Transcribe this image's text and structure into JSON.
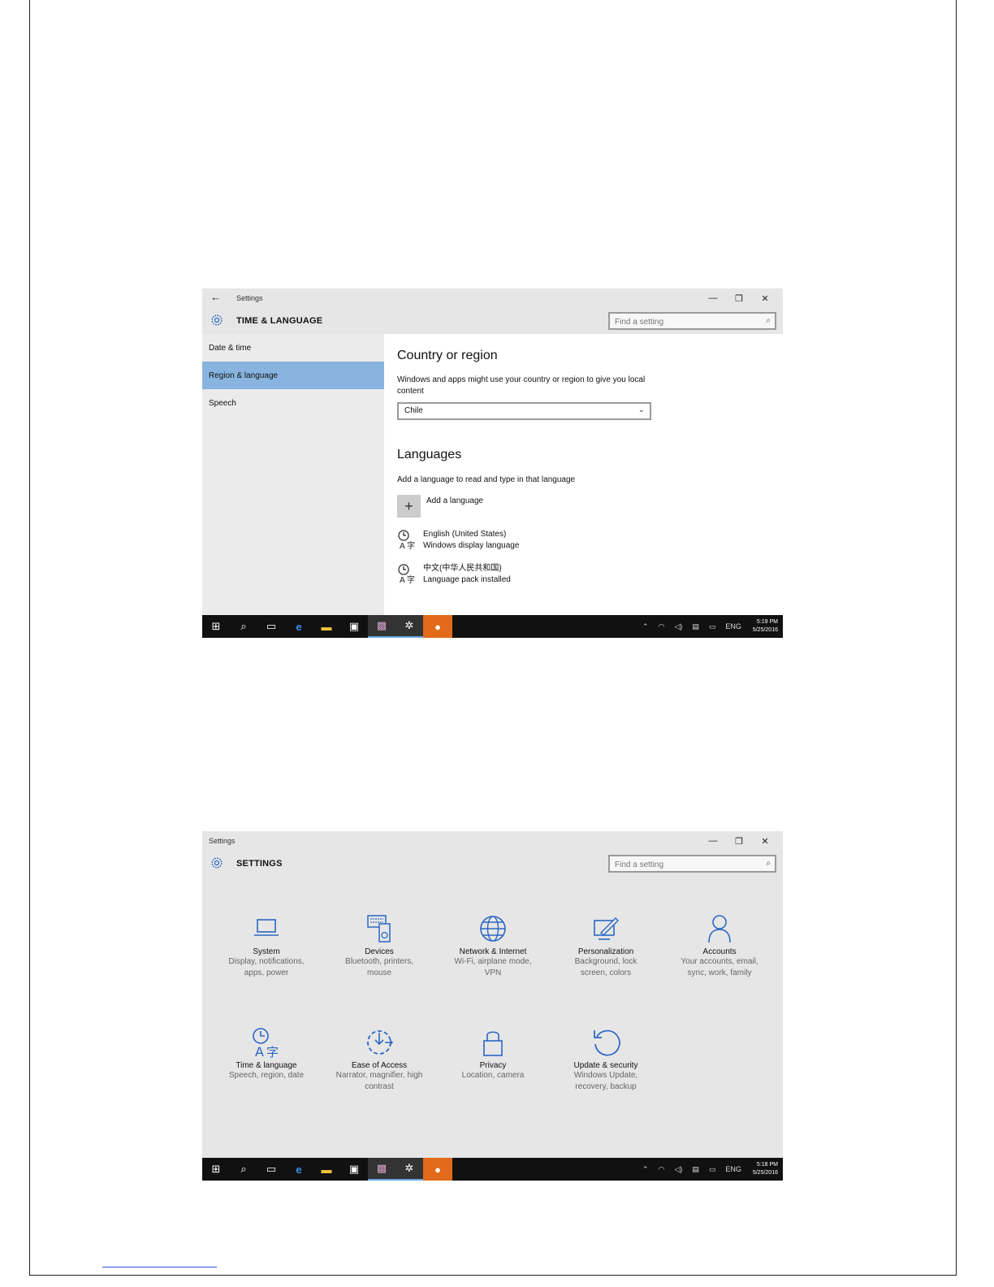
{
  "shot1": {
    "titlebar_title": "Settings",
    "header_title": "TIME & LANGUAGE",
    "search_placeholder": "Find a setting",
    "sidebar": [
      {
        "label": "Date & time",
        "active": false
      },
      {
        "label": "Region & language",
        "active": true
      },
      {
        "label": "Speech",
        "active": false
      }
    ],
    "country": {
      "title": "Country or region",
      "description": "Windows and apps might use your country or region to give you local content",
      "selected": "Chile"
    },
    "languages": {
      "title": "Languages",
      "description": "Add a language to read and type in that language",
      "add_label": "Add a language",
      "items": [
        {
          "name": "English (United States)",
          "status": "Windows display language"
        },
        {
          "name": "中文(中华人民共和国)",
          "status": "Language pack installed"
        }
      ]
    },
    "tray": {
      "lang": "ENG",
      "time": "5:19 PM",
      "date": "5/25/2016"
    }
  },
  "shot2": {
    "titlebar_title": "Settings",
    "header_title": "SETTINGS",
    "search_placeholder": "Find a setting",
    "tiles": [
      {
        "icon": "laptop-icon",
        "label": "System",
        "desc": "Display, notifications, apps, power"
      },
      {
        "icon": "devices-icon",
        "label": "Devices",
        "desc": "Bluetooth, printers, mouse"
      },
      {
        "icon": "globe-icon",
        "label": "Network & Internet",
        "desc": "Wi-Fi, airplane mode, VPN"
      },
      {
        "icon": "personalization-icon",
        "label": "Personalization",
        "desc": "Background, lock screen, colors"
      },
      {
        "icon": "person-icon",
        "label": "Accounts",
        "desc": "Your accounts, email, sync, work, family"
      },
      {
        "icon": "time-language-icon",
        "label": "Time & language",
        "desc": "Speech, region, date"
      },
      {
        "icon": "ease-of-access-icon",
        "label": "Ease of Access",
        "desc": "Narrator, magnifier, high contrast"
      },
      {
        "icon": "lock-icon",
        "label": "Privacy",
        "desc": "Location, camera"
      },
      {
        "icon": "update-icon",
        "label": "Update & security",
        "desc": "Windows Update, recovery, backup"
      }
    ],
    "tray": {
      "lang": "ENG",
      "time": "5:18 PM",
      "date": "5/25/2016"
    }
  },
  "accent_color": "#2b67c4",
  "selection_color": "#88b4df"
}
